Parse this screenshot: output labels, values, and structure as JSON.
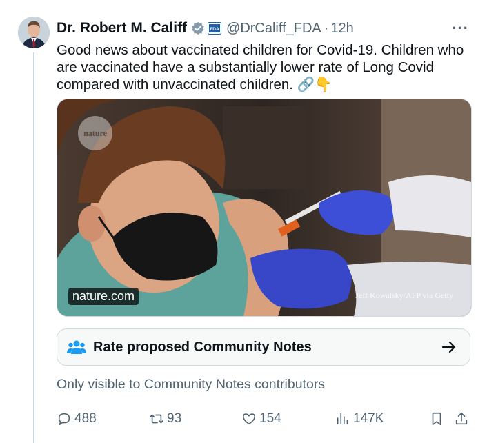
{
  "author": {
    "display_name": "Dr. Robert M. Califf",
    "handle": "@DrCaliff_FDA",
    "separator": "·",
    "time": "12h",
    "org_badge": "FDA"
  },
  "tweet": {
    "text": "Good news about vaccinated children for Covid-19.  Children who are vaccinated have a substantially lower rate of Long Covid compared with unvaccinated children. 🔗👇"
  },
  "card": {
    "domain": "nature.com",
    "logo_text": "nature",
    "photo_credit": "Jeff Kowalsky/AFP via Getty"
  },
  "community_notes": {
    "button_label": "Rate proposed Community Notes",
    "visibility_note": "Only visible to Community Notes contributors"
  },
  "actions": {
    "replies": "488",
    "retweets": "93",
    "likes": "154",
    "views": "147K"
  },
  "colors": {
    "verified_badge": "#829aab",
    "text_primary": "#0f1419",
    "text_secondary": "#536471",
    "community_icon": "#1d9bf0"
  }
}
